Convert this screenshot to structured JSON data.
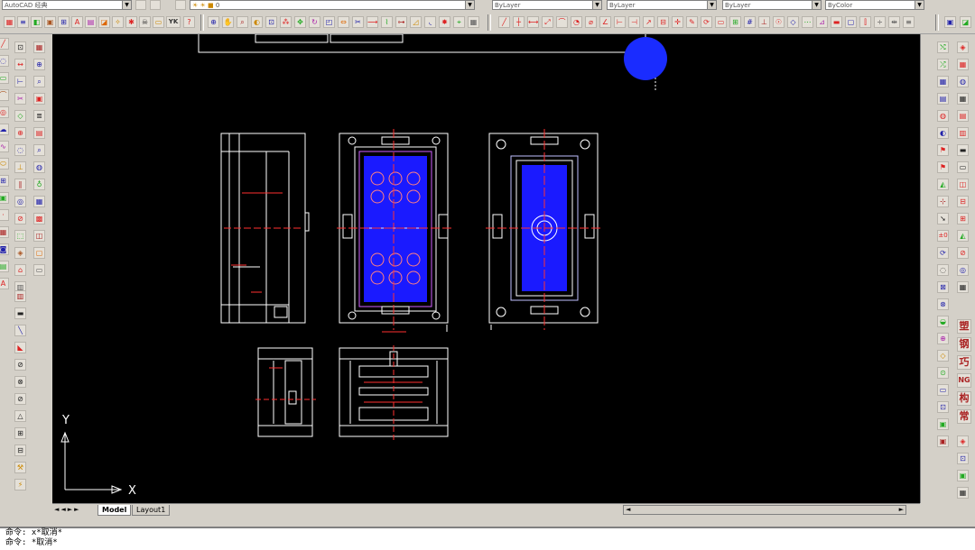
{
  "top_bar": {
    "workspace": "AutoCAD 经典",
    "layer_value": "0",
    "yk_label": "YK",
    "layer_combo": "ByLayer",
    "linetype_combo": "ByLayer",
    "lineweight_combo": "ByLayer",
    "plotstyle_combo": "ByColor"
  },
  "canvas": {
    "axis_y": "Y",
    "axis_x": "X"
  },
  "tabs": {
    "model": "Model",
    "layout": "Layout1"
  },
  "right_tools": [
    "塑",
    "钢",
    "巧",
    "NG",
    "构",
    "常"
  ],
  "left_tools": [
    "line",
    "pline",
    "polygon",
    "rect",
    "arc",
    "circle",
    "cloud",
    "spline",
    "ellipse",
    "insert",
    "block",
    "point",
    "hatch",
    "region",
    "table",
    "mtext"
  ],
  "command": {
    "line1": "命令: x*取消*",
    "line2": "命令: *取消*"
  },
  "colors": {
    "canvas_bg": "#000000",
    "geometry": "#ffffff",
    "cavity": "#1a1aff",
    "centerline": "#ff3030",
    "cursor_blob": "#1a2cff"
  }
}
